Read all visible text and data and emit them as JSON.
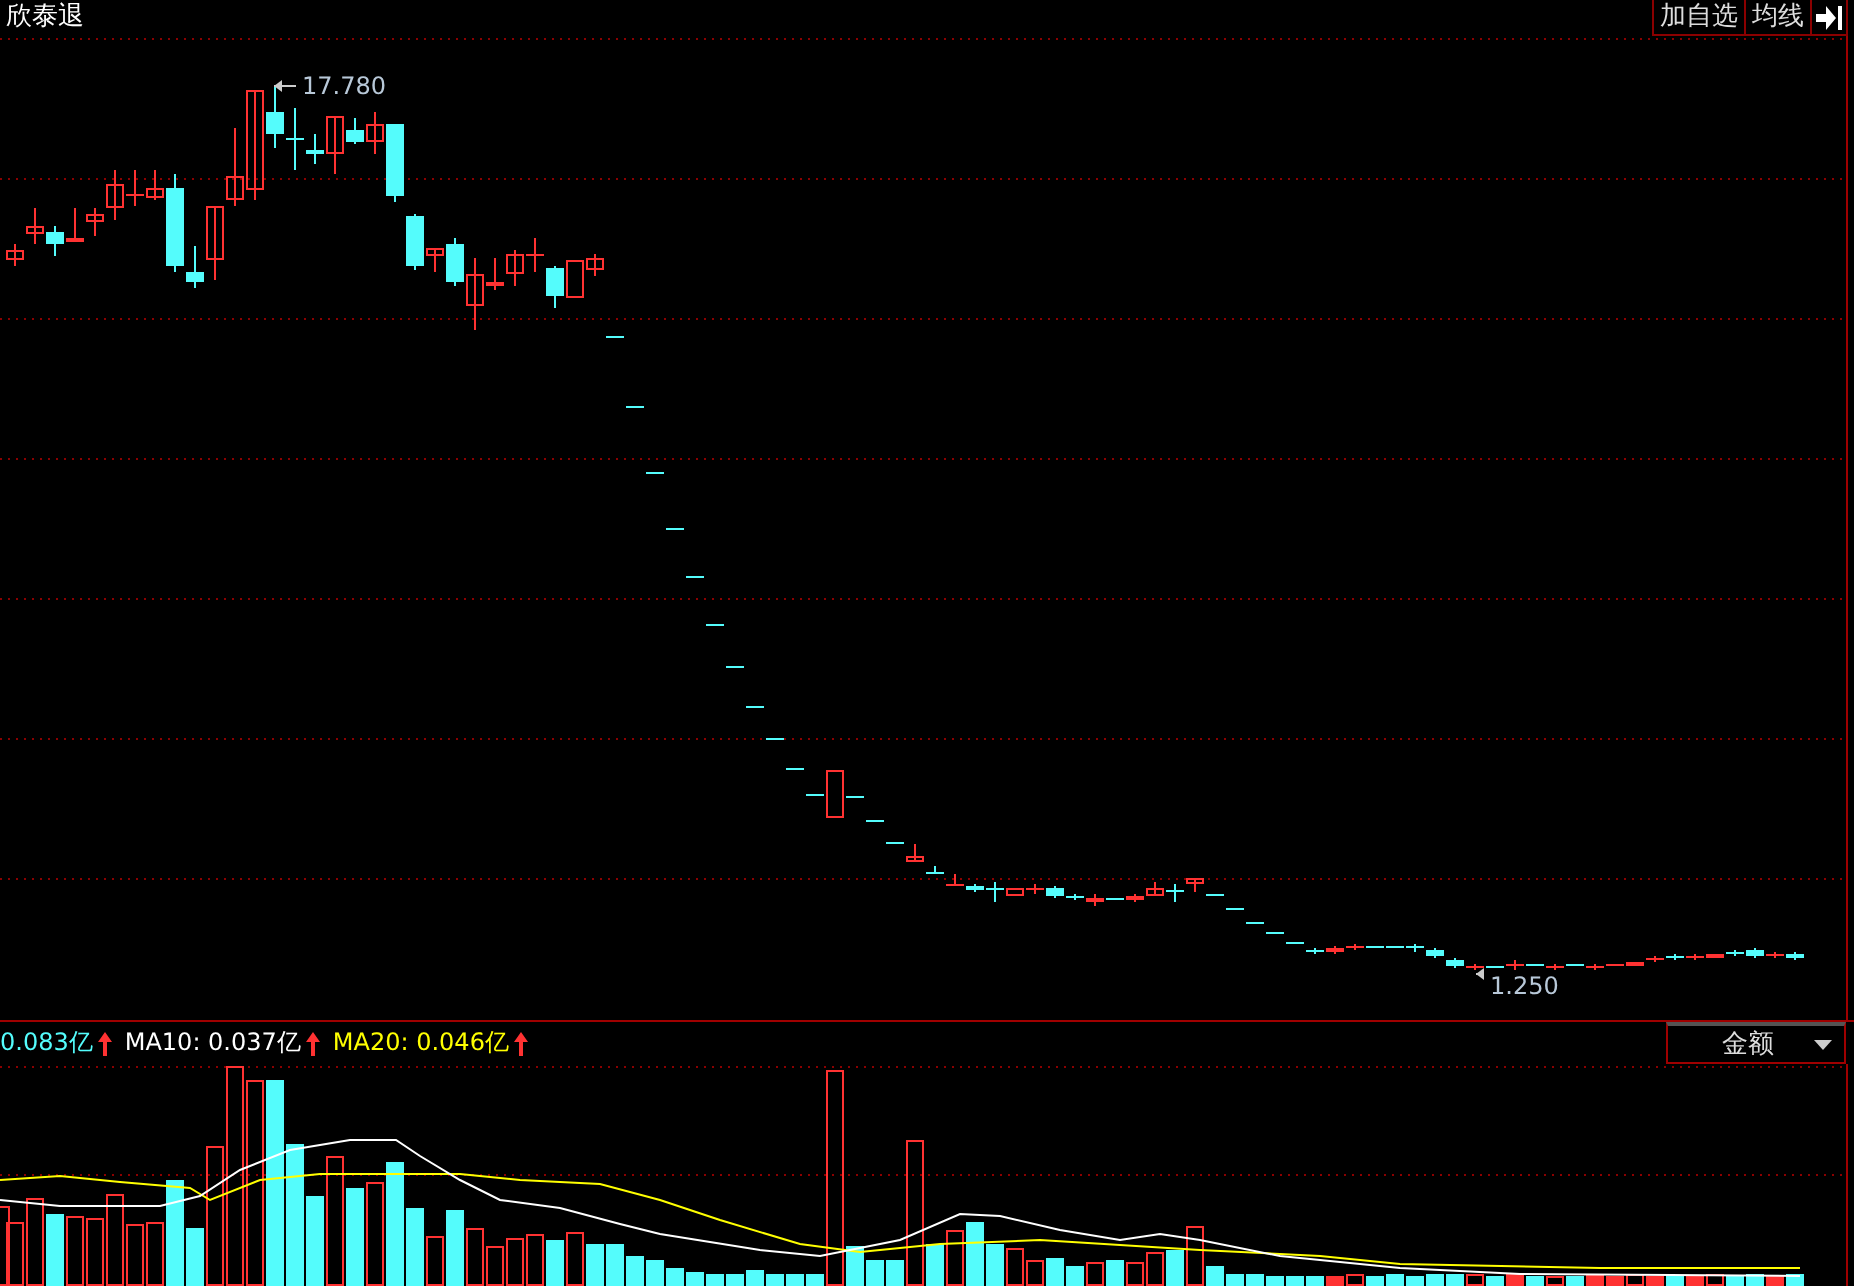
{
  "title": "欣泰退",
  "buttons": [
    {
      "label": "加自选"
    },
    {
      "label": "均线"
    }
  ],
  "price_chart": {
    "high_label": "17.780",
    "low_label": "1.250"
  },
  "volume_legend": [
    {
      "text": "0.083亿",
      "color": "#54fcfc"
    },
    {
      "text": "MA10: 0.037亿",
      "color": "#ffffff"
    },
    {
      "text": "MA20: 0.046亿",
      "color": "#ffff00"
    }
  ],
  "volume_selector": {
    "value": "金额"
  }
}
